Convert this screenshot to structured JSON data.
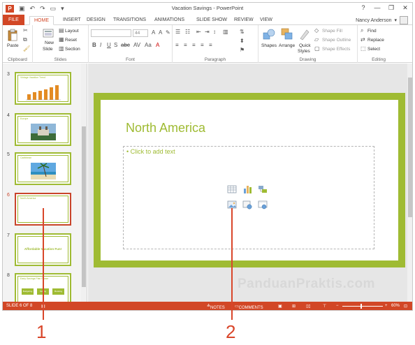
{
  "window": {
    "title": "Vacation Savings - PowerPoint",
    "user": "Nancy Anderson",
    "controls": [
      "?",
      "—",
      "❐",
      "✕"
    ]
  },
  "tabs": [
    {
      "label": "FILE"
    },
    {
      "label": "HOME"
    },
    {
      "label": "INSERT"
    },
    {
      "label": "DESIGN"
    },
    {
      "label": "TRANSITIONS"
    },
    {
      "label": "ANIMATIONS"
    },
    {
      "label": "SLIDE SHOW"
    },
    {
      "label": "REVIEW"
    },
    {
      "label": "VIEW"
    }
  ],
  "ribbon": {
    "clipboard": {
      "label": "Clipboard",
      "paste": "Paste"
    },
    "slides": {
      "label": "Slides",
      "new_slide_1": "New",
      "new_slide_2": "Slide",
      "layout": "Layout",
      "reset": "Reset",
      "section": "Section"
    },
    "font": {
      "label": "Font",
      "size": "44"
    },
    "paragraph": {
      "label": "Paragraph"
    },
    "drawing": {
      "label": "Drawing",
      "shapes": "Shapes",
      "arrange": "Arrange",
      "quick_styles_1": "Quick",
      "quick_styles_2": "Styles",
      "shape_fill": "Shape Fill",
      "shape_outline": "Shape Outline",
      "shape_effects": "Shape Effects"
    },
    "editing": {
      "label": "Editing",
      "find": "Find",
      "replace": "Replace",
      "select": "Select"
    }
  },
  "thumbnails": [
    {
      "num": "3",
      "title": "Vintage Vacation Trend"
    },
    {
      "num": "4",
      "title": "Europe"
    },
    {
      "num": "5",
      "title": "Caribbean"
    },
    {
      "num": "6",
      "title": "North America"
    },
    {
      "num": "7",
      "title": "Affordable Vacation Fun!"
    },
    {
      "num": "8",
      "title": "Early Savings Plan Phase"
    }
  ],
  "thumb8_boxes": [
    "Budgeting",
    "Saving",
    "Booking"
  ],
  "slide": {
    "title": "North America",
    "placeholder": "Click to add text"
  },
  "statusbar": {
    "slide": "SLIDE 6 OF 8",
    "notes": "NOTES",
    "comments": "COMMENTS",
    "zoom": "60%"
  },
  "watermark": "PanduanPraktis.com",
  "callouts": [
    "1",
    "2"
  ],
  "colors": {
    "accent": "#d24726",
    "theme_green": "#9fbb33",
    "callout": "#d9462a"
  }
}
